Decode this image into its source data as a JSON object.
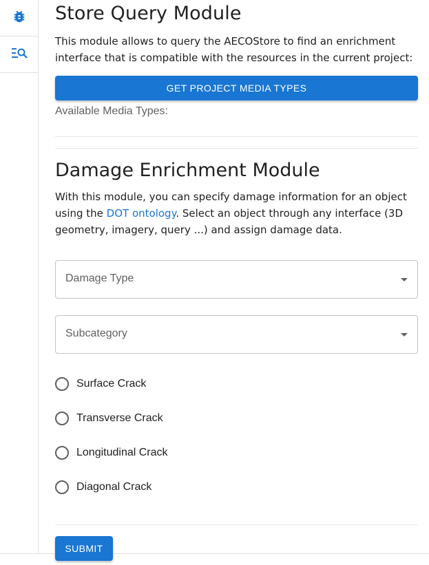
{
  "sidebar": {
    "items": [
      {
        "icon": "bug-icon"
      },
      {
        "icon": "list-search-icon"
      }
    ]
  },
  "store_query": {
    "title": "Store Query Module",
    "description": "This module allows to query the AECOStore to find an enrichment interface that is compatible with the resources in the current project:",
    "button_label": "GET PROJECT MEDIA TYPES",
    "available_label": "Available Media Types:"
  },
  "damage": {
    "title": "Damage Enrichment Module",
    "description_before": "With this module, you can specify damage information for an object using the ",
    "link_text": "DOT ontology",
    "description_after": ". Select an object through any interface (3D geometry, imagery, query ...) and assign damage data.",
    "damage_type_placeholder": "Damage Type",
    "subcategory_placeholder": "Subcategory",
    "options": [
      "Surface Crack",
      "Transverse Crack",
      "Longitudinal Crack",
      "Diagonal Crack"
    ],
    "submit_label": "SUBMIT"
  },
  "colors": {
    "primary": "#1976d2",
    "icon": "#1976d2"
  }
}
